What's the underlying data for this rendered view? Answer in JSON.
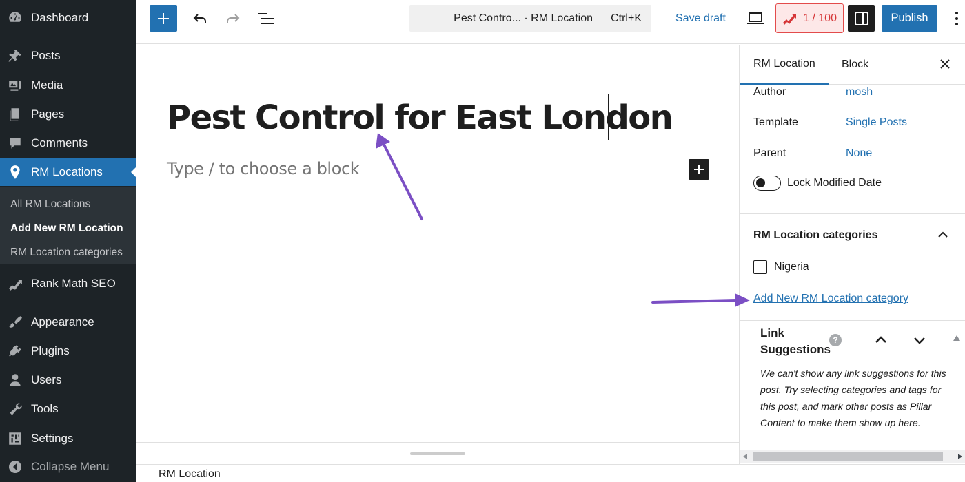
{
  "admin_menu": {
    "items": [
      {
        "label": "Dashboard",
        "icon": "dashboard-icon"
      },
      {
        "label": "Posts",
        "icon": "pin-icon"
      },
      {
        "label": "Media",
        "icon": "media-icon"
      },
      {
        "label": "Pages",
        "icon": "pages-icon"
      },
      {
        "label": "Comments",
        "icon": "comments-icon"
      },
      {
        "label": "RM Locations",
        "icon": "location-pin-icon"
      },
      {
        "label": "Rank Math SEO",
        "icon": "rank-math-icon"
      },
      {
        "label": "Appearance",
        "icon": "paintbrush-icon"
      },
      {
        "label": "Plugins",
        "icon": "plugin-icon"
      },
      {
        "label": "Users",
        "icon": "user-icon"
      },
      {
        "label": "Tools",
        "icon": "wrench-icon"
      },
      {
        "label": "Settings",
        "icon": "settings-icon"
      }
    ],
    "submenu": [
      "All RM Locations",
      "Add New RM Location",
      "RM Location categories"
    ],
    "collapse_label": "Collapse Menu"
  },
  "toolbar": {
    "command_title": "Pest Contro... · RM Location",
    "command_shortcut": "Ctrl+K",
    "save_draft": "Save draft",
    "rank_score": "1 / 100",
    "publish": "Publish"
  },
  "editor": {
    "post_title": "Pest Control for East London",
    "block_placeholder": "Type / to choose a block"
  },
  "footer": {
    "breadcrumb": "RM Location"
  },
  "sidebar": {
    "tabs": [
      "RM Location",
      "Block"
    ],
    "fields": [
      {
        "label": "Author",
        "value": "mosh"
      },
      {
        "label": "Template",
        "value": "Single Posts"
      },
      {
        "label": "Parent",
        "value": "None"
      }
    ],
    "lock_modified_date": "Lock Modified Date",
    "lock_modified_enabled": false,
    "categories": {
      "title": "RM Location categories",
      "items": [
        {
          "label": "Nigeria",
          "checked": false
        }
      ],
      "add_new_link": "Add New RM Location category"
    },
    "link_suggestions": {
      "title": "Link Suggestions",
      "message": "We can't show any link suggestions for this post. Try selecting categories and tags for this post, and mark other posts as Pillar Content to make them show up here."
    }
  },
  "colors": {
    "admin_bg": "#1d2327",
    "accent": "#2271b1",
    "annotation_arrow": "#7b4fc4",
    "score_red": "#d63638"
  }
}
